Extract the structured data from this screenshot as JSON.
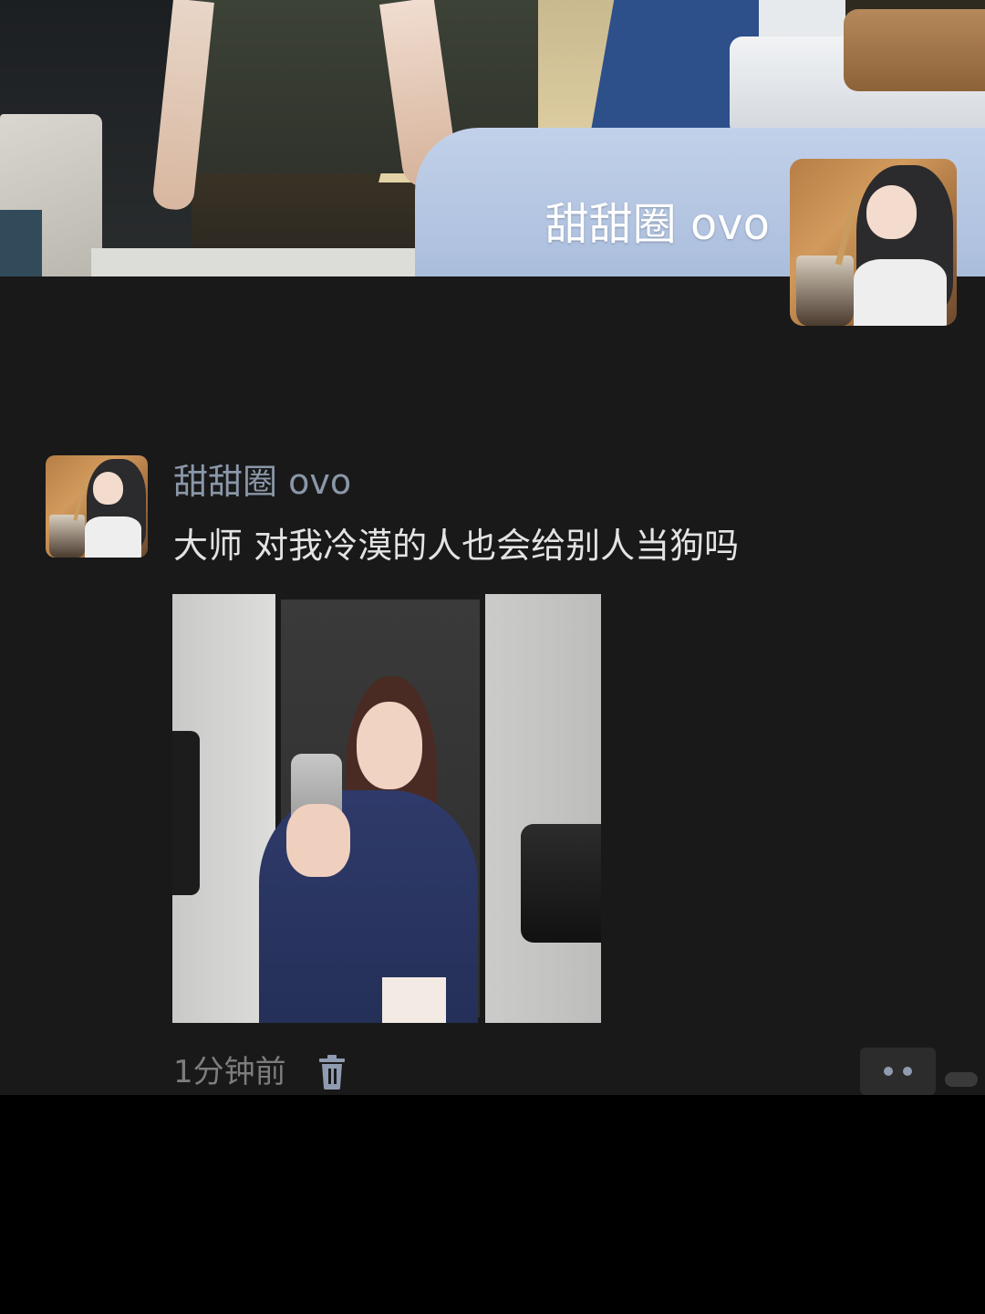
{
  "profile": {
    "name": "甜甜圈 ovo"
  },
  "post": {
    "author": "甜甜圈 ovo",
    "text": "大师 对我冷漠的人也会给别人当狗吗",
    "time": "1分钟前"
  },
  "icons": {
    "delete": "trash-icon",
    "more": "more-dots-icon"
  },
  "colors": {
    "background": "#191919",
    "author_name": "#8a97a9",
    "text": "#e3e3e3",
    "time": "#7c7c7c",
    "more_dots": "#8f9bb0"
  }
}
